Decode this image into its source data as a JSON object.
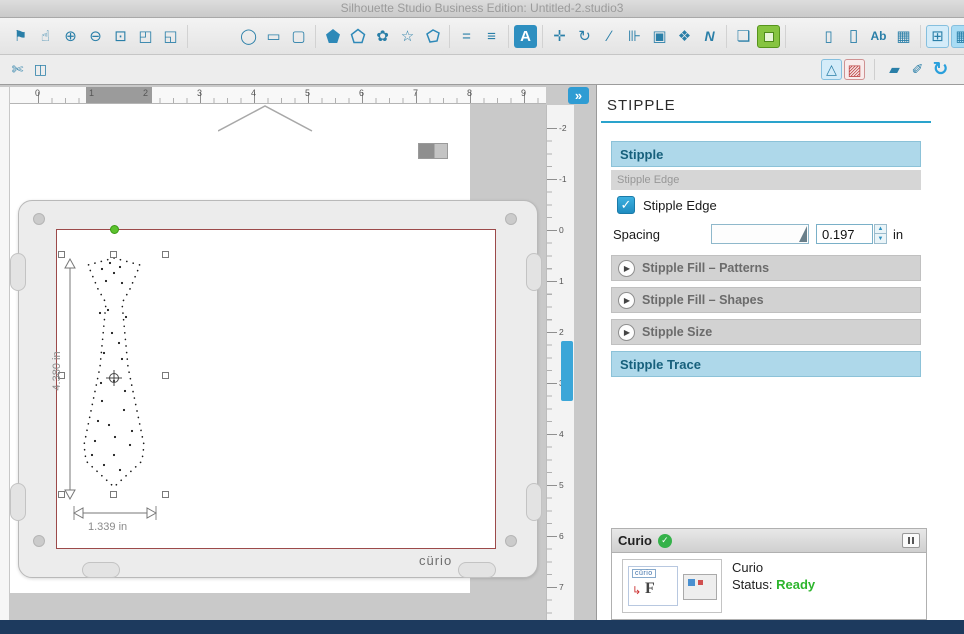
{
  "titlebar": {
    "title": "Silhouette Studio Business Edition: Untitled-2.studio3"
  },
  "toolbar_main": {
    "groups": [
      {
        "icons": [
          {
            "name": "flag-select-tool-icon"
          },
          {
            "name": "pan-hand-tool-icon"
          },
          {
            "name": "zoom-in-tool-icon"
          },
          {
            "name": "zoom-out-tool-icon"
          },
          {
            "name": "zoom-selection-tool-icon"
          },
          {
            "name": "drag-zoom-tool-icon"
          },
          {
            "name": "fit-to-page-tool-icon"
          }
        ]
      },
      {
        "cls": "gap-a",
        "icons": [
          {
            "name": "ellipse-tool-icon"
          },
          {
            "name": "rectangle-tool-icon"
          },
          {
            "name": "rounded-rectangle-tool-icon"
          }
        ]
      },
      {
        "icons": [
          {
            "name": "regular-polygon-tool-icon"
          },
          {
            "name": "shape-tool-icon"
          },
          {
            "name": "flower-tool-icon"
          },
          {
            "name": "star-tool-icon"
          },
          {
            "name": "freeform-polygon-tool-icon"
          }
        ]
      },
      {
        "icons": [
          {
            "name": "line-tool-icon"
          },
          {
            "name": "polyline-tool-icon"
          }
        ]
      },
      {
        "icons": [
          {
            "name": "text-tool-icon",
            "style": "solid-blue"
          }
        ]
      },
      {
        "icons": [
          {
            "name": "move-tool-icon"
          },
          {
            "name": "rotate-tool-icon"
          },
          {
            "name": "shear-tool-icon"
          },
          {
            "name": "align-tool-icon"
          },
          {
            "name": "replicate-tool-icon"
          },
          {
            "name": "modify-tool-icon"
          },
          {
            "name": "nesting-tool-icon",
            "style": "nest"
          }
        ]
      },
      {
        "icons": [
          {
            "name": "note-tool-icon"
          },
          {
            "name": "fill-color-tool-icon",
            "style": "green-swatch"
          }
        ]
      },
      {
        "cls": "gap-b",
        "icons": [
          {
            "name": "phone-connect-icon"
          },
          {
            "name": "tablet-connect-icon",
            "style": "tall"
          },
          {
            "name": "text-style-icon",
            "style": "small-label"
          },
          {
            "name": "grid-table-icon"
          }
        ]
      },
      {
        "cls": "push-right",
        "icons": [
          {
            "name": "page-setup-icon",
            "style": "active"
          },
          {
            "name": "grid-settings-icon",
            "style": "active selected"
          }
        ]
      },
      {
        "icons": [
          {
            "name": "preferences-gear-icon",
            "style": "gear-blue"
          }
        ]
      }
    ]
  },
  "toolbar_secondary": {
    "left_groups": [
      {
        "icons": [
          {
            "name": "blade-settings-icon"
          },
          {
            "name": "emboss-tool-icon"
          }
        ]
      }
    ],
    "right_groups": [
      {
        "icons": [
          {
            "name": "stipple-panel-icon",
            "style": "active"
          },
          {
            "name": "pattern-fill-icon",
            "style": "red-pattern"
          }
        ]
      },
      {
        "icons": [
          {
            "name": "eraser-tool-icon"
          },
          {
            "name": "knife-tool-icon"
          },
          {
            "name": "sync-icon",
            "style": "sync-blue"
          }
        ]
      }
    ]
  },
  "rulers": {
    "horizontal": [
      "0",
      "1",
      "2",
      "3",
      "4",
      "5",
      "6",
      "7",
      "8",
      "9"
    ],
    "vertical": [
      "-2",
      "-1",
      "0",
      "1",
      "2",
      "3",
      "4",
      "5",
      "6",
      "7"
    ]
  },
  "canvas": {
    "mat_logo": "cürio",
    "selection": {
      "height_label": "4.380 in",
      "width_label": "1.339 in"
    }
  },
  "panel": {
    "title": "STIPPLE",
    "stipple_header": "Stipple",
    "stipple_edge_subheader": "Stipple Edge",
    "stipple_edge_label": "Stipple Edge",
    "stipple_edge_checked": true,
    "spacing_label": "Spacing",
    "spacing_value": "0.197",
    "spacing_unit": "in",
    "collapsed_sections": [
      "Stipple Fill – Patterns",
      "Stipple Fill – Shapes",
      "Stipple Size"
    ],
    "stipple_trace_header": "Stipple Trace",
    "curio": {
      "title": "Curio",
      "device_name": "Curio",
      "status_label": "Status:",
      "status_value": "Ready",
      "thumb_logo": "cürio",
      "thumb_letter": "F"
    }
  },
  "colors": {
    "accent": "#2e9fd4",
    "ready_green": "#2db52d",
    "panel_header_bg": "#aed8ea",
    "footer_navy": "#1d3a5e"
  }
}
